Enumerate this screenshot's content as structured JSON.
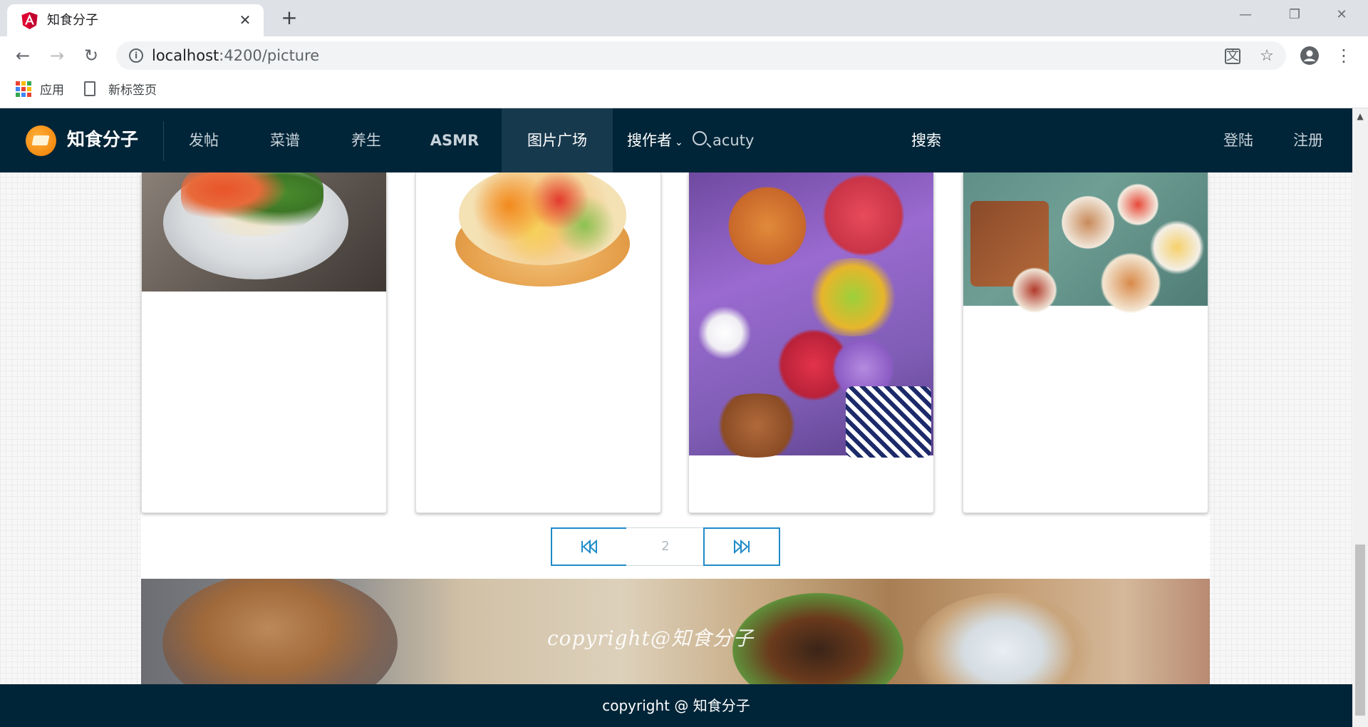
{
  "browser": {
    "tab_title": "知食分子",
    "tab_close_glyph": "✕",
    "new_tab_glyph": "+",
    "url_host": "localhost",
    "url_path": ":4200/picture",
    "bookmarks": [
      "应用",
      "新标签页"
    ],
    "window_buttons": [
      "—",
      "❐",
      "✕"
    ]
  },
  "navbar": {
    "brand": "知食分子",
    "items": [
      "发帖",
      "菜谱",
      "养生",
      "ASMR",
      "图片广场"
    ],
    "active_item": "图片广场",
    "author_dropdown": "搜作者",
    "search_value": "acuty",
    "search_button": "搜索",
    "login": "登陆",
    "register": "注册"
  },
  "pagination": {
    "first_glyph": "⏪",
    "current_page": "2",
    "last_glyph": "⏩"
  },
  "banner": {
    "text": "copyright@知食分子"
  },
  "footer": {
    "text": "copyright @ 知食分子"
  },
  "colors": {
    "navbar_bg": "#002538",
    "active_nav_bg": "#17394d",
    "pager_accent": "#1f8bc9"
  }
}
